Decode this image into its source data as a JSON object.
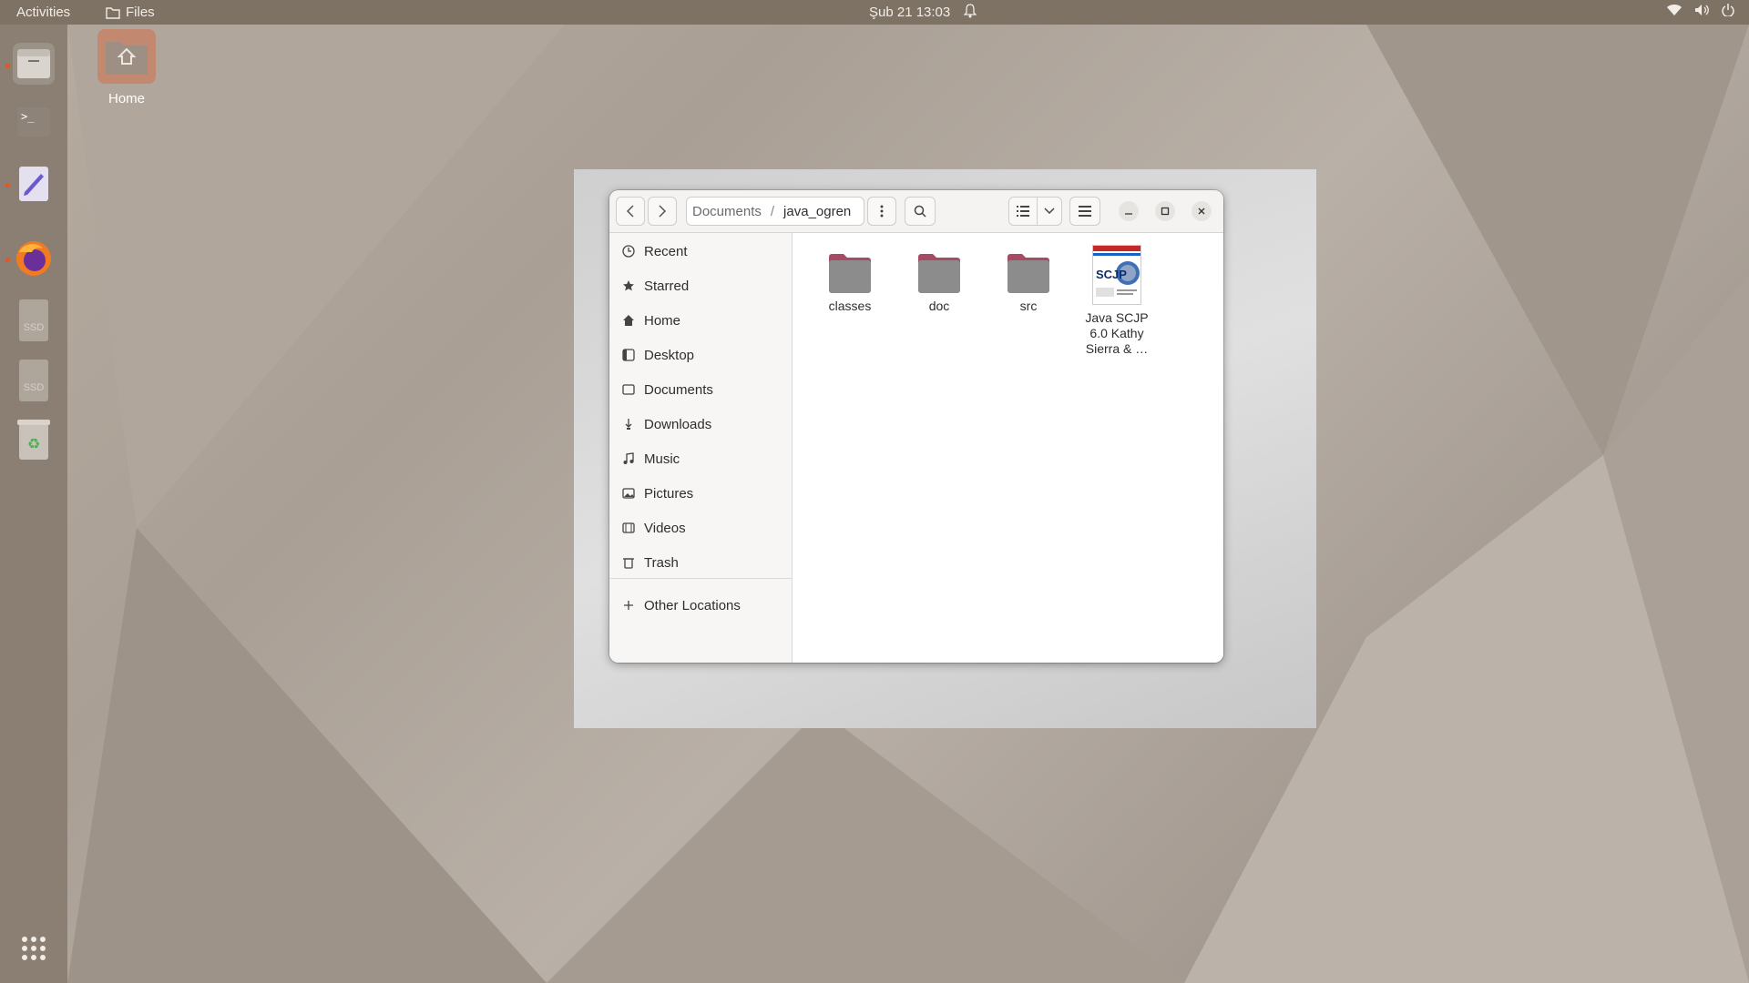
{
  "topbar": {
    "activities": "Activities",
    "app_name": "Files",
    "clock": "Şub 21  13:03"
  },
  "desktop": {
    "home_label": "Home"
  },
  "dock": {
    "items": [
      "files-icon",
      "terminal-icon",
      "text-editor-icon",
      "firefox-icon",
      "ssd-drive-icon",
      "ssd-drive-icon",
      "trash-icon",
      "app-grid-icon"
    ],
    "ssd_label": "SSD"
  },
  "window": {
    "path": {
      "parent": "Documents",
      "current": "java_ogren",
      "separator": "/"
    },
    "sidebar": {
      "items": [
        {
          "label": "Recent",
          "icon": "clock-icon"
        },
        {
          "label": "Starred",
          "icon": "star-icon"
        },
        {
          "label": "Home",
          "icon": "home-icon"
        },
        {
          "label": "Desktop",
          "icon": "desktop-icon"
        },
        {
          "label": "Documents",
          "icon": "document-icon"
        },
        {
          "label": "Downloads",
          "icon": "download-icon"
        },
        {
          "label": "Music",
          "icon": "music-icon"
        },
        {
          "label": "Pictures",
          "icon": "picture-icon"
        },
        {
          "label": "Videos",
          "icon": "video-icon"
        },
        {
          "label": "Trash",
          "icon": "trash-icon"
        }
      ],
      "other_locations": "Other Locations"
    },
    "files": [
      {
        "name": "classes",
        "type": "folder"
      },
      {
        "name": "doc",
        "type": "folder"
      },
      {
        "name": "src",
        "type": "folder"
      },
      {
        "name": "Java SCJP 6.0 Kathy Sierra & …",
        "type": "document",
        "thumb_text": "SCJP"
      }
    ]
  },
  "colors": {
    "accent": "#e95420",
    "folder": "#8c8c8c",
    "folder_tab": "#a64b63"
  }
}
